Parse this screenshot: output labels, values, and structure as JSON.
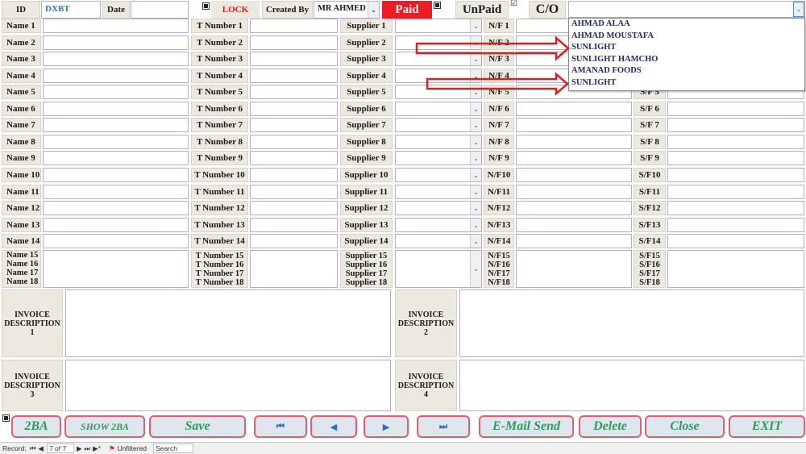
{
  "header": {
    "id_label": "ID",
    "id_value": "DXBT",
    "date_label": "Date",
    "date_value": "",
    "lock_label": "LOCK",
    "created_by_label": "Created By",
    "created_by_value": "MR AHMED",
    "paid_label": "Paid",
    "unpaid_label": "UnPaid",
    "co_label": "C/O",
    "supplier_search_value": ""
  },
  "rows": [
    {
      "name": "Name 1",
      "tnum": "T Number 1",
      "supplier": "Supplier 1",
      "nf": "N/F 1",
      "sf": ""
    },
    {
      "name": "Name 2",
      "tnum": "T Number 2",
      "supplier": "Supplier 2",
      "nf": "N/F 2",
      "sf": ""
    },
    {
      "name": "Name 3",
      "tnum": "T Number 3",
      "supplier": "Supplier 3",
      "nf": "N/F 3",
      "sf": ""
    },
    {
      "name": "Name 4",
      "tnum": "T Number 4",
      "supplier": "Supplier 4",
      "nf": "N/F 4",
      "sf": ""
    },
    {
      "name": "Name 5",
      "tnum": "T Number 5",
      "supplier": "Supplier 5",
      "nf": "N/F 5",
      "sf": "S/F 5"
    },
    {
      "name": "Name 6",
      "tnum": "T Number 6",
      "supplier": "Supplier 6",
      "nf": "N/F 6",
      "sf": "S/F 6"
    },
    {
      "name": "Name 7",
      "tnum": "T Number 7",
      "supplier": "Supplier 7",
      "nf": "N/F 7",
      "sf": "S/F 7"
    },
    {
      "name": "Name 8",
      "tnum": "T Number 8",
      "supplier": "Supplier 8",
      "nf": "N/F 8",
      "sf": "S/F 8"
    },
    {
      "name": "Name 9",
      "tnum": "T Number 9",
      "supplier": "Supplier 9",
      "nf": "N/F 9",
      "sf": "S/F 9"
    },
    {
      "name": "Name 10",
      "tnum": "T Number 10",
      "supplier": "Supplier 10",
      "nf": "N/F10",
      "sf": "S/F10"
    },
    {
      "name": "Name 11",
      "tnum": "T Number 11",
      "supplier": "Supplier 11",
      "nf": "N/F11",
      "sf": "S/F11"
    },
    {
      "name": "Name 12",
      "tnum": "T Number 12",
      "supplier": "Supplier 12",
      "nf": "N/F12",
      "sf": "S/F12"
    },
    {
      "name": "Name 13",
      "tnum": "T Number 13",
      "supplier": "Supplier 13",
      "nf": "N/F13",
      "sf": "S/F13"
    },
    {
      "name": "Name 14",
      "tnum": "T Number 14",
      "supplier": "Supplier 14",
      "nf": "N/F14",
      "sf": "S/F14"
    }
  ],
  "multi_row": {
    "names": [
      "Name 15",
      "Name 16",
      "Name 17",
      "Name 18"
    ],
    "tnums": [
      "T Number 15",
      "T Number 16",
      "T Number 17",
      "T Number 18"
    ],
    "suppliers": [
      "Supplier 15",
      "Supplier 16",
      "Supplier 17",
      "Supplier 18"
    ],
    "nfs": [
      "N/F15",
      "N/F16",
      "N/F17",
      "N/F18"
    ],
    "sfs": [
      "S/F15",
      "S/F16",
      "S/F17",
      "S/F18"
    ]
  },
  "invoice": {
    "desc1_label": "INVOICE DESCRIPTION  1",
    "desc2_label": "INVOICE DESCRIPTION 2",
    "desc3_label": "INVOICE DESCRIPTION 3",
    "desc4_label": "INVOICE DESCRIPTION 4"
  },
  "supplier_dropdown": {
    "options": [
      "AHMAD ALAA",
      "AHMAD MOUSTAFA",
      "SUNLIGHT",
      "SUNLIGHT HAMCHO",
      "AMANAD FOODS",
      "SUNLIGHT"
    ]
  },
  "buttons": {
    "twoba": "2BA",
    "show2ba": "SHOW 2BA",
    "save": "Save",
    "first_icon": "first-record-icon",
    "prev_icon": "previous-record-icon",
    "next_icon": "next-record-icon",
    "last_icon": "last-record-icon",
    "email": "E-Mail Send",
    "delete": "Delete",
    "close": "Close",
    "exit": "EXIT"
  },
  "statusbar": {
    "record_label": "Record:",
    "record_value": "7 of 7",
    "filter_label": "Unfiltered",
    "search_label": "Search"
  },
  "colors": {
    "paid_bg": "#ee1c24",
    "lock_text": "#e02020",
    "id_value_text": "#2a7ad0",
    "button_text": "#2e9a5c",
    "button_border": "#e06070",
    "arrow": "#e02020"
  }
}
